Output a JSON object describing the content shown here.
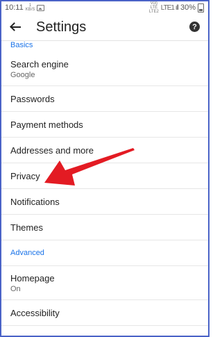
{
  "status": {
    "time": "10:11",
    "mini_line1": "1",
    "mini_line2": "KB/S",
    "network_line1": "Vol)",
    "network_line2": "LTE",
    "network_line3": "LTE2",
    "signal": "LTE1 ıll",
    "battery": "30%"
  },
  "appbar": {
    "title": "Settings",
    "help": "?"
  },
  "sections": {
    "basics": "Basics",
    "advanced": "Advanced"
  },
  "items": {
    "search_engine": {
      "label": "Search engine",
      "sub": "Google"
    },
    "passwords": {
      "label": "Passwords"
    },
    "payment": {
      "label": "Payment methods"
    },
    "addresses": {
      "label": "Addresses and more"
    },
    "privacy": {
      "label": "Privacy"
    },
    "notifications": {
      "label": "Notifications"
    },
    "themes": {
      "label": "Themes"
    },
    "homepage": {
      "label": "Homepage",
      "sub": "On"
    },
    "accessibility": {
      "label": "Accessibility"
    }
  },
  "colors": {
    "accent": "#1a73e8",
    "arrow": "#e31b23",
    "frame": "#4a63c7"
  }
}
